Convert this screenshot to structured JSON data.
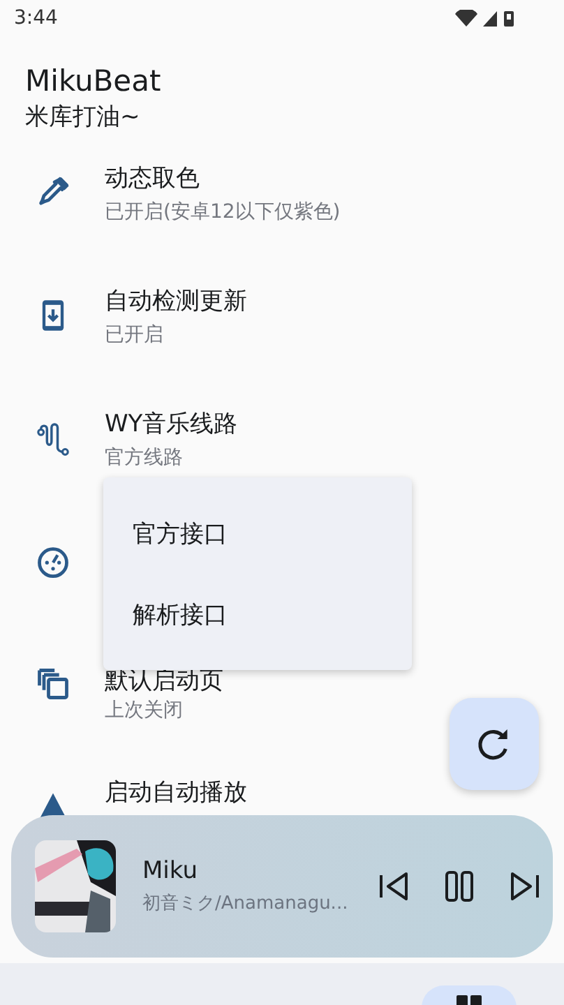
{
  "status_bar": {
    "time": "3:44"
  },
  "header": {
    "title": "MikuBeat",
    "subtitle": "米库打油~"
  },
  "settings": [
    {
      "kind": "text",
      "title": "动态取色",
      "subtitle": "已开启(安卓12以下仅紫色)"
    },
    {
      "kind": "text",
      "title": "自动检测更新",
      "subtitle": "已开启"
    },
    {
      "kind": "text",
      "title": "WY音乐线路",
      "subtitle": "官方线路"
    },
    {
      "kind": "covered"
    },
    {
      "kind": "text",
      "title": "默认启动页",
      "subtitle": "上次关闭"
    },
    {
      "kind": "text",
      "title": "启动自动播放"
    }
  ],
  "menu": {
    "items": [
      {
        "label": "官方接口"
      },
      {
        "label": "解析接口"
      }
    ]
  },
  "player": {
    "title": "Miku",
    "artist": "初音ミク/Anamanagu..."
  },
  "nav": {
    "items": [
      {
        "selected": true
      }
    ]
  }
}
